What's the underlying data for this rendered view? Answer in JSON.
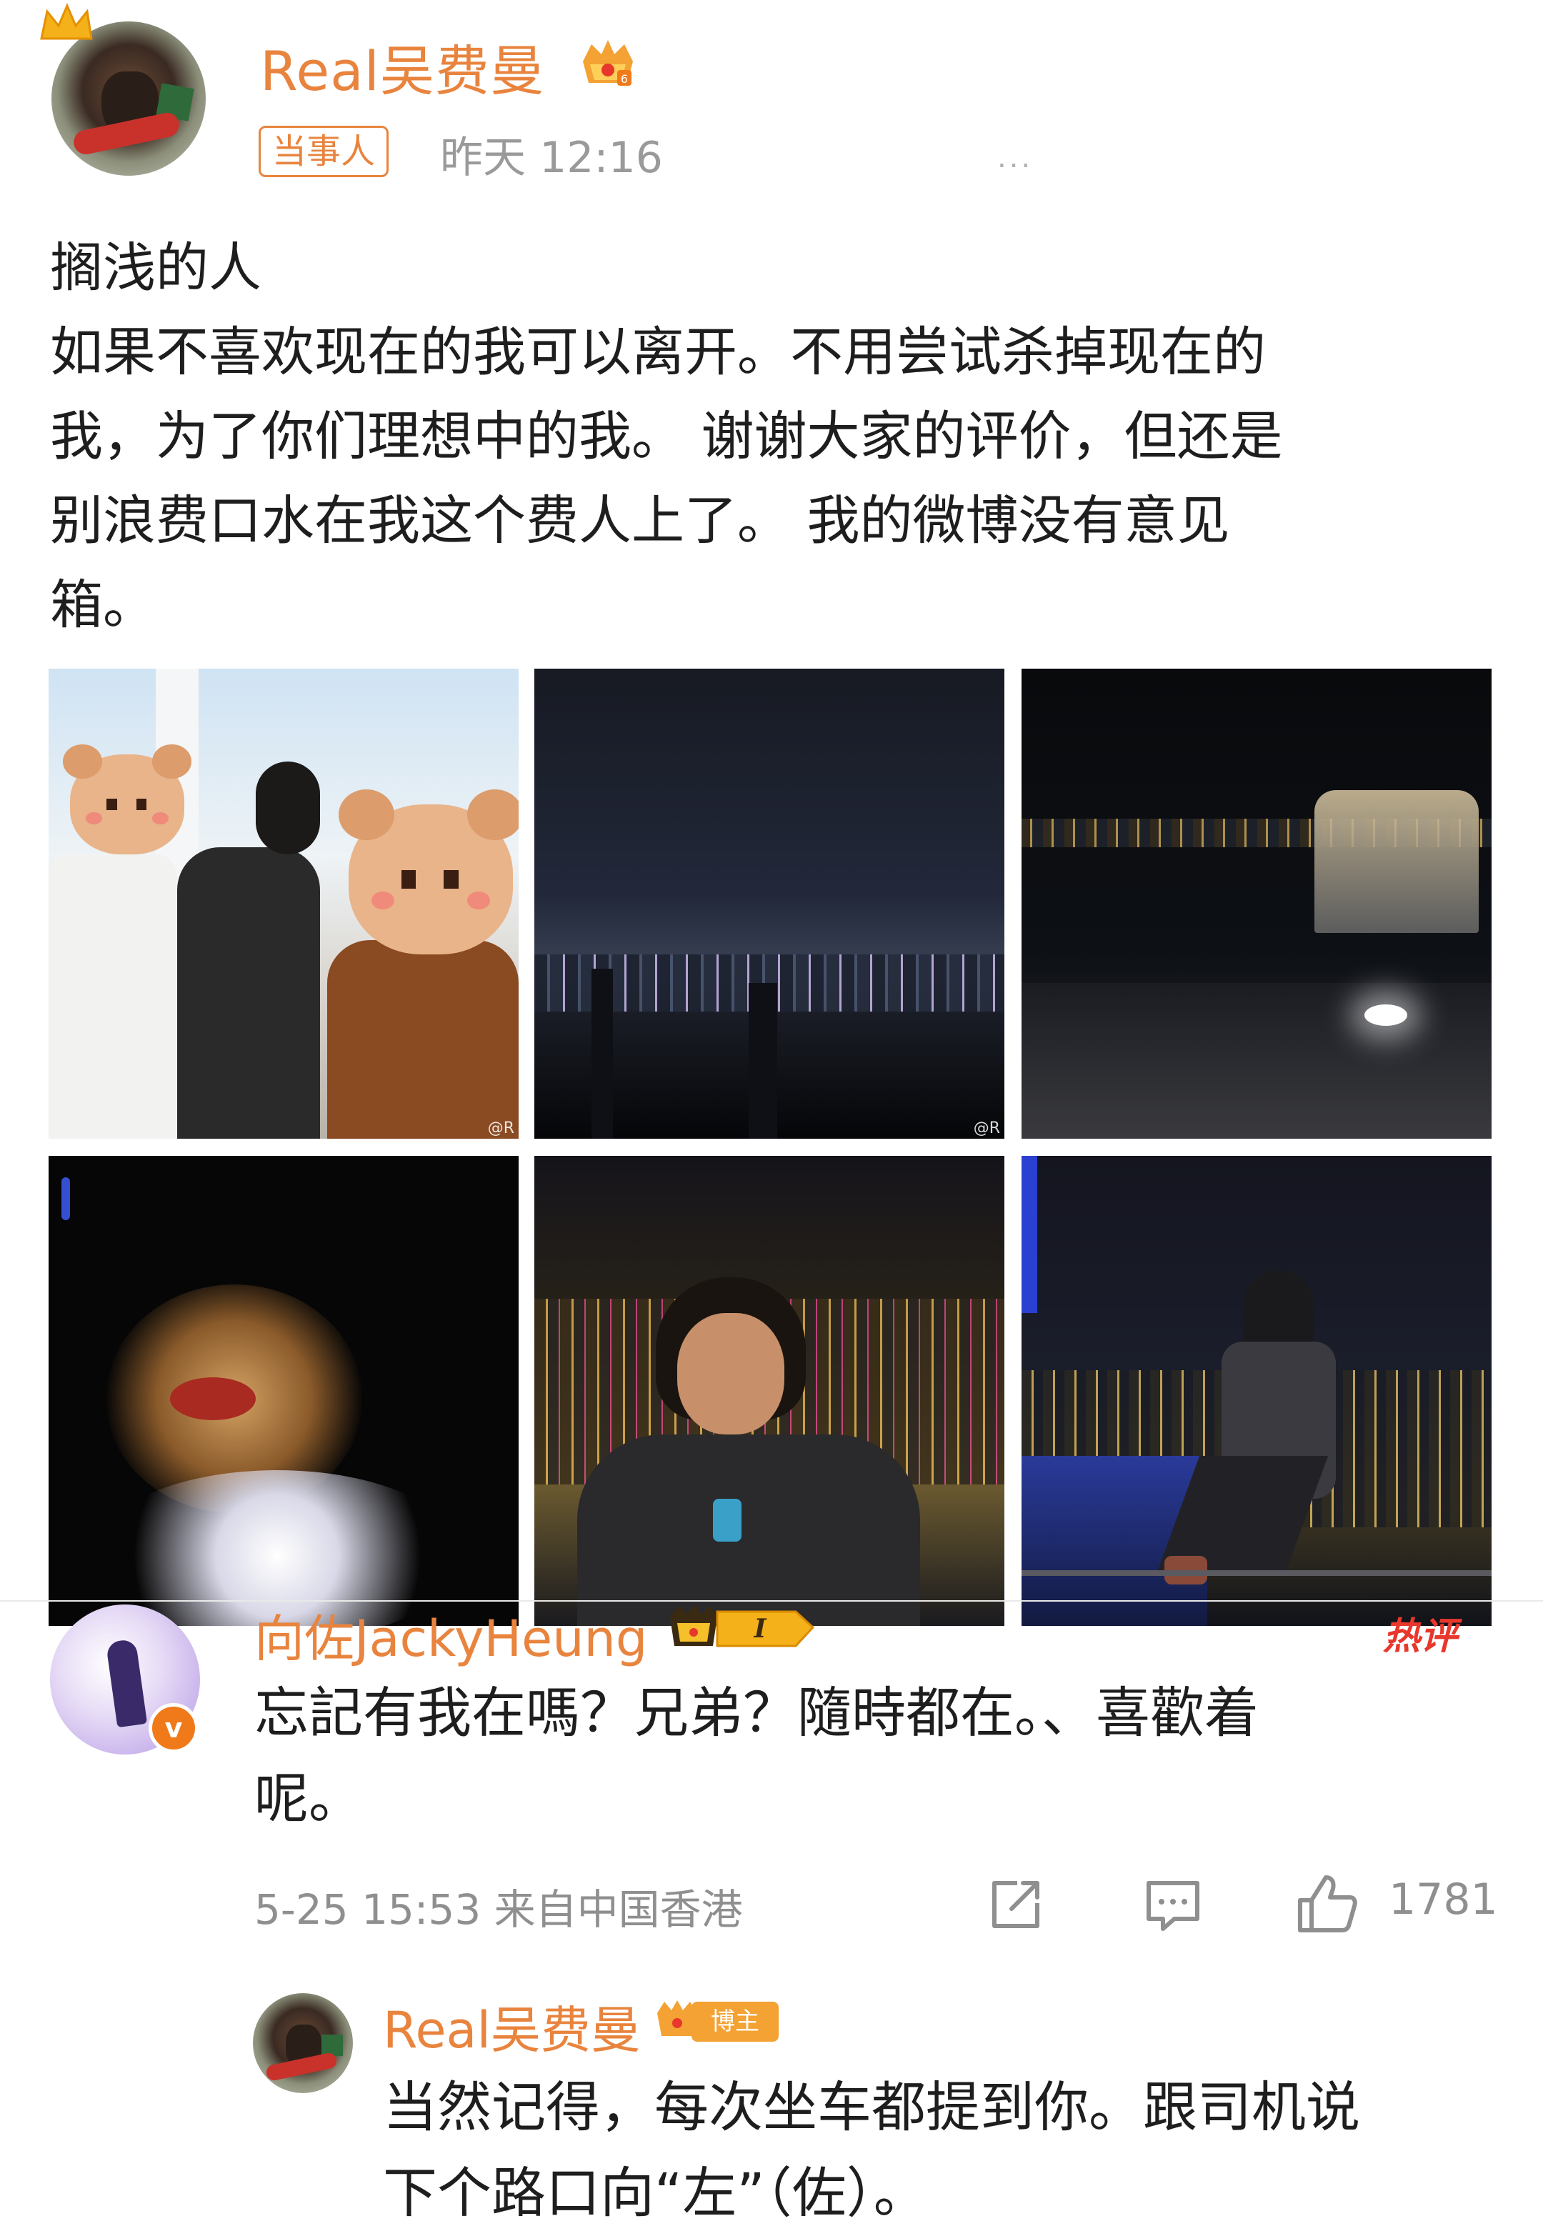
{
  "post": {
    "author": "Real吴费曼",
    "tag": "当事人",
    "time": "昨天 12:16",
    "more": "...",
    "body_lines": [
      "搁浅的人",
      "如果不喜欢现在的我可以离开。不用尝试杀掉现在的",
      "我，为了你们理想中的我。 谢谢大家的评价，但还是",
      "别浪费口水在我这个费人上了。 我的微博没有意见",
      "箱。"
    ],
    "photo_watermark": "@R"
  },
  "comment": {
    "author": "向佐JackyHeung",
    "vip_level": "I",
    "hot_label": "热评",
    "text_lines": [
      "忘記有我在嗎？兄弟？隨時都在。、喜歡着",
      "呢。"
    ],
    "meta": "5-25 15:53 来自中国香港",
    "likes": "1781",
    "verified_mark": "v"
  },
  "reply": {
    "author": "Real吴费曼",
    "badge": "博主",
    "text_lines": [
      "当然记得，每次坐车都提到你。跟司机说",
      "下个路口向“左”（佐）。"
    ]
  },
  "colors": {
    "accent": "#e8843e",
    "hot": "#e8372c",
    "meta": "#8f8f8f",
    "text": "#1e1e1e"
  }
}
